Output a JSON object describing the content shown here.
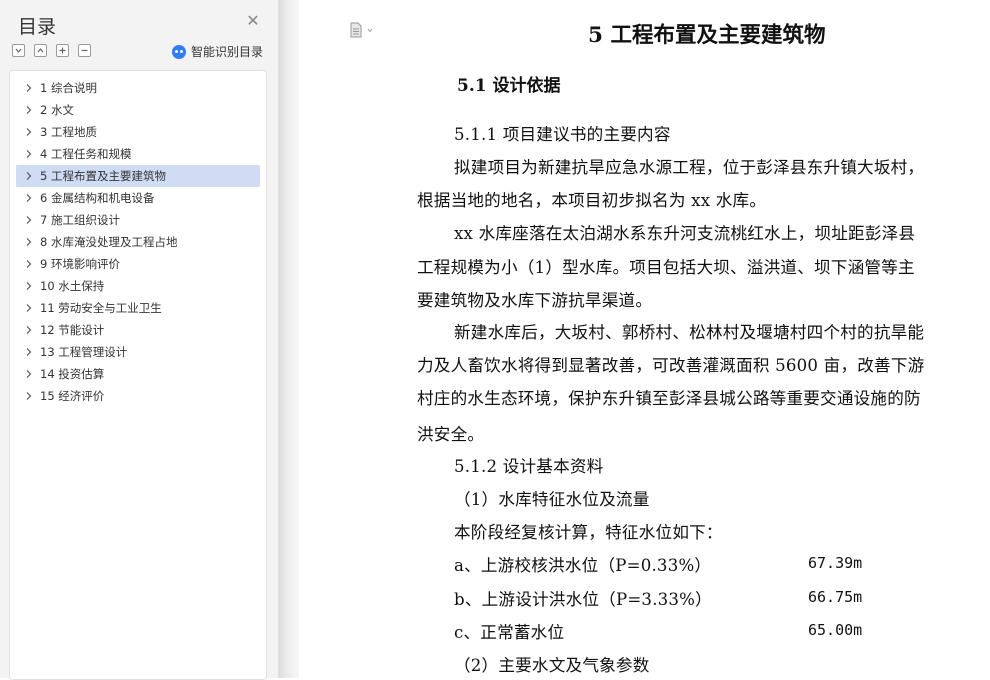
{
  "sidebar": {
    "title": "目录",
    "smart_toc_label": "智能识别目录",
    "items": [
      {
        "label": "1 综合说明",
        "active": false
      },
      {
        "label": "2 水文",
        "active": false
      },
      {
        "label": "3 工程地质",
        "active": false
      },
      {
        "label": "4 工程任务和规模",
        "active": false
      },
      {
        "label": "5 工程布置及主要建筑物",
        "active": true
      },
      {
        "label": "6 金属结构和机电设备",
        "active": false
      },
      {
        "label": "7 施工组织设计",
        "active": false
      },
      {
        "label": "8 水库淹没处理及工程占地",
        "active": false
      },
      {
        "label": "9 环境影响评价",
        "active": false
      },
      {
        "label": "10 水土保持",
        "active": false
      },
      {
        "label": "11 劳动安全与工业卫生",
        "active": false
      },
      {
        "label": "12 节能设计",
        "active": false
      },
      {
        "label": "13 工程管理设计",
        "active": false
      },
      {
        "label": "14 投资估算",
        "active": false
      },
      {
        "label": "15 经济评价",
        "active": false
      }
    ]
  },
  "document": {
    "chapter_title": "5 工程布置及主要建筑物",
    "section_title": "5.1 设计依据",
    "lines": {
      "l1": "5.1.1 项目建议书的主要内容",
      "l2": "拟建项目为新建抗旱应急水源工程，位于彭泽县东升镇大坂村，",
      "l3": "根据当地的地名，本项目初步拟名为 xx 水库。",
      "l4": "xx 水库座落在太泊湖水系东升河支流桃红水上，坝址距彭泽县",
      "l5": "工程规模为小（1）型水库。项目包括大坝、溢洪道、坝下涵管等主",
      "l6": "要建筑物及水库下游抗旱渠道。",
      "l7": "新建水库后，大坂村、郭桥村、松林村及堰塘村四个村的抗旱能",
      "l8": "力及人畜饮水将得到显著改善，可改善灌溉面积 5600 亩，改善下游",
      "l9": "村庄的水生态环境，保护东升镇至彭泽县城公路等重要交通设施的防",
      "l10": "洪安全。",
      "l11": "5.1.2 设计基本资料",
      "l12": "（1）水库特征水位及流量",
      "l13": "本阶段经复核计算，特征水位如下：",
      "l17": "（2）主要水文及气象参数"
    },
    "levels": [
      {
        "label": "a、上游校核洪水位（P=0.33%）",
        "value": "67.39m"
      },
      {
        "label": "b、上游设计洪水位（P=3.33%）",
        "value": "66.75m"
      },
      {
        "label": "c、正常蓄水位",
        "value": "65.00m"
      }
    ]
  }
}
